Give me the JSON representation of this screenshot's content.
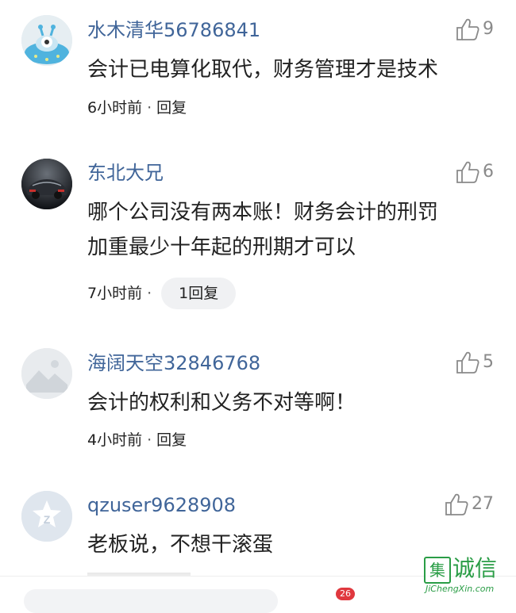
{
  "comments": [
    {
      "username": "水木清华56786841",
      "likes": "9",
      "text_lines": [
        "会计已电算化取代，财务管理才是技术"
      ],
      "time": "6小时前",
      "separator": "·",
      "reply": "回复",
      "avatar": "cartoon-alien-avatar"
    },
    {
      "username": "东北大兄",
      "likes": "6",
      "text_lines": [
        "哪个公司没有两本账！财务会计的刑罚",
        "加重最少十年起的刑期才可以"
      ],
      "time": "7小时前",
      "separator": "·",
      "reply": "1回复",
      "avatar": "car-photo-avatar"
    },
    {
      "username": "海阔天空32846768",
      "likes": "5",
      "text_lines": [
        "会计的权利和义务不对等啊！"
      ],
      "time": "4小时前",
      "separator": "·",
      "reply": "回复",
      "avatar": "placeholder-image-avatar"
    },
    {
      "username": "qzuser9628908",
      "likes": "27",
      "text_lines": [
        "老板说，不想干滚蛋"
      ],
      "time": "",
      "separator": "",
      "reply": "",
      "avatar": "default-avatar"
    }
  ],
  "bottom_bar": {
    "badge_count": "26"
  },
  "watermark": {
    "chars": "诚信",
    "box_char": "集",
    "url": "JiChengXin.com"
  },
  "colors": {
    "username": "#406599",
    "text": "#222222",
    "meta_gray": "#8a8a8a",
    "pill_bg": "#f0f1f3",
    "badge": "#e0383e",
    "watermark": "#2a9d46"
  }
}
